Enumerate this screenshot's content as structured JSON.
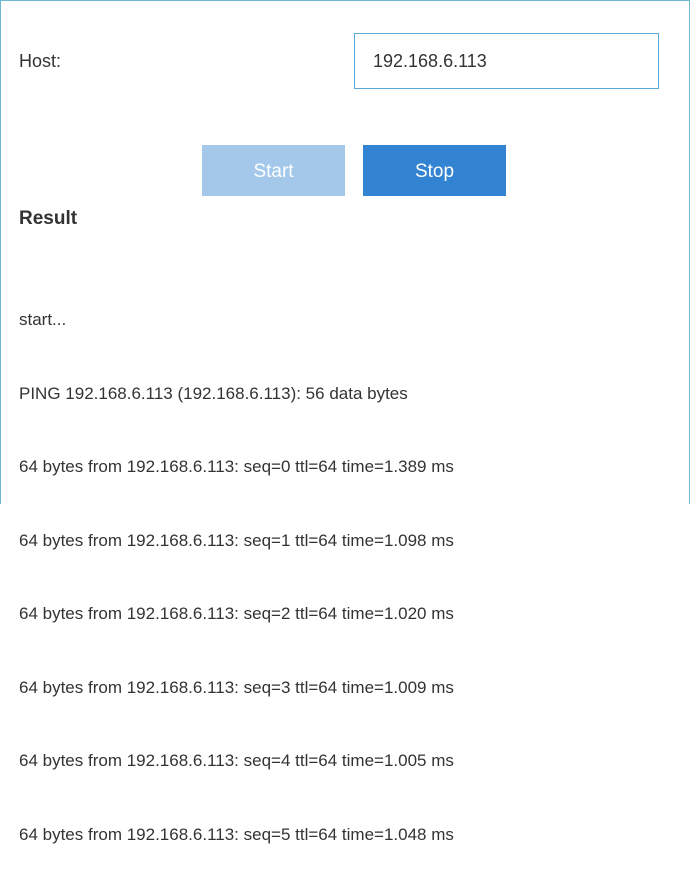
{
  "form": {
    "host_label": "Host:",
    "host_value": "192.168.6.113"
  },
  "buttons": {
    "start_label": "Start",
    "start_enabled": false,
    "stop_label": "Stop"
  },
  "result": {
    "title": "Result",
    "lines": [
      "start...",
      "PING 192.168.6.113 (192.168.6.113): 56 data bytes",
      "64 bytes from 192.168.6.113: seq=0 ttl=64 time=1.389 ms",
      "64 bytes from 192.168.6.113: seq=1 ttl=64 time=1.098 ms",
      "64 bytes from 192.168.6.113: seq=2 ttl=64 time=1.020 ms",
      "64 bytes from 192.168.6.113: seq=3 ttl=64 time=1.009 ms",
      "64 bytes from 192.168.6.113: seq=4 ttl=64 time=1.005 ms",
      "64 bytes from 192.168.6.113: seq=5 ttl=64 time=1.048 ms"
    ]
  },
  "colors": {
    "frame_border": "#6fb7d3",
    "input_border": "#5aa9d6",
    "start_disabled_bg": "#a3c8ea",
    "stop_bg": "#3283d1",
    "text": "#333333"
  }
}
